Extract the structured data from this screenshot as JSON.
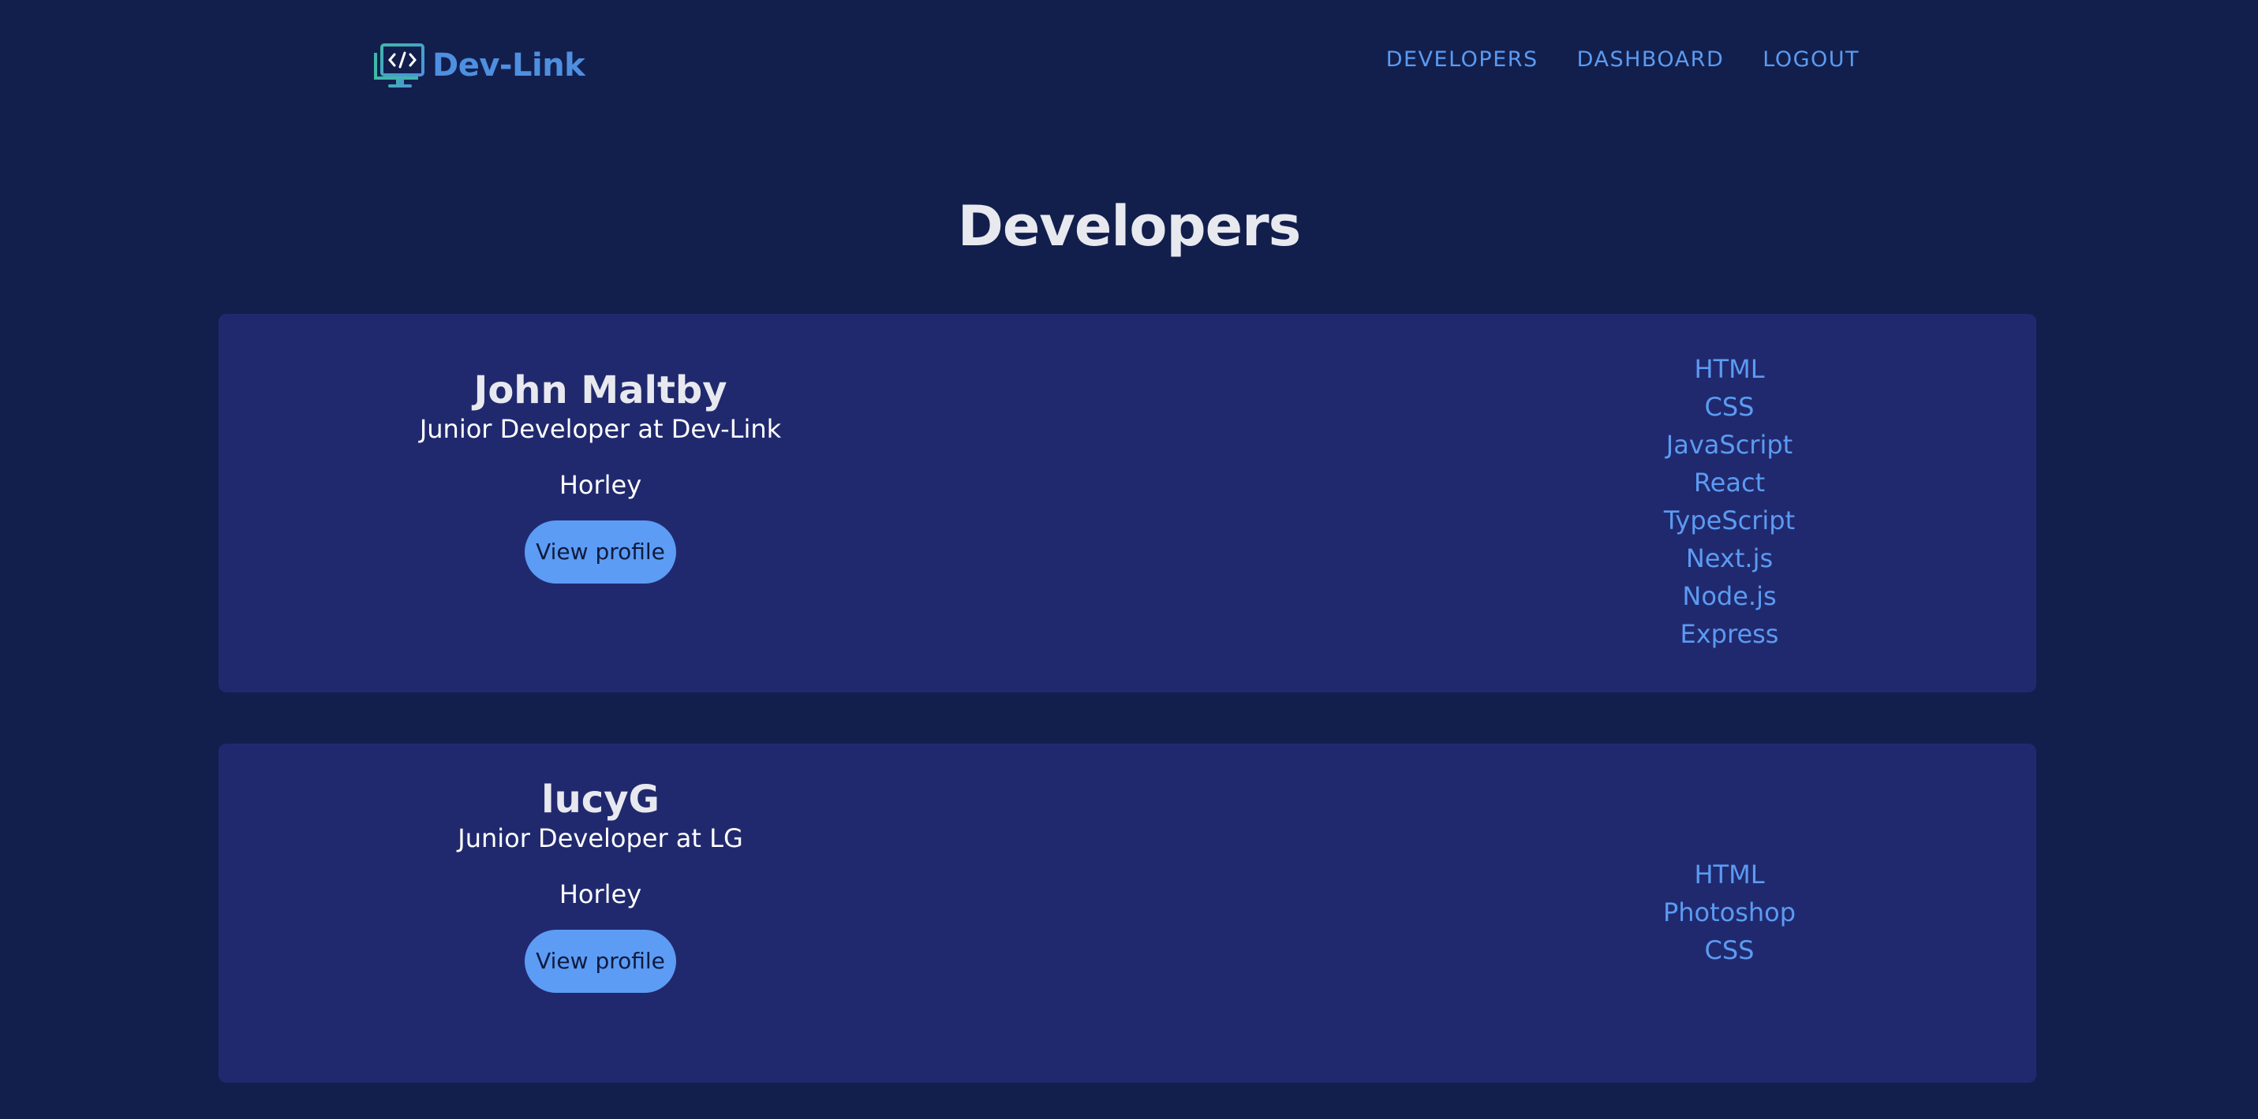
{
  "header": {
    "logo_text": "Dev-Link",
    "nav": [
      {
        "label": "DEVELOPERS"
      },
      {
        "label": "DASHBOARD"
      },
      {
        "label": "LOGOUT"
      }
    ]
  },
  "main": {
    "title": "Developers",
    "developers": [
      {
        "name": "John Maltby",
        "status": "Junior Developer at Dev-Link",
        "location": "Horley",
        "button_label": "View profile",
        "skills": [
          "HTML",
          "CSS",
          "JavaScript",
          "React",
          "TypeScript",
          "Next.js",
          "Node.js",
          "Express"
        ]
      },
      {
        "name": "lucyG",
        "status": "Junior Developer at LG",
        "location": "Horley",
        "button_label": "View profile",
        "skills": [
          "HTML",
          "Photoshop",
          "CSS"
        ]
      }
    ]
  },
  "colors": {
    "background": "#121f4d",
    "card": "#21296e",
    "accent": "#5b9bf2",
    "button": "#5c9cf5",
    "title": "#e8e9ef"
  },
  "icons": {
    "logo": "monitor-code-icon"
  }
}
